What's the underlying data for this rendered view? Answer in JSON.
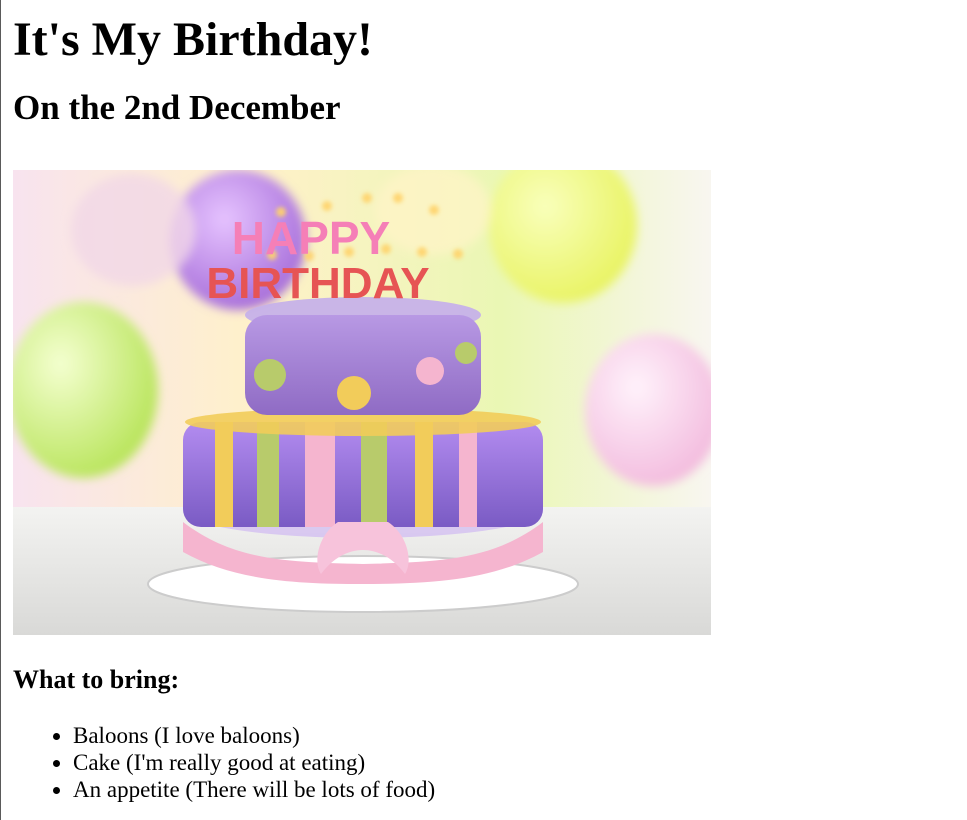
{
  "page": {
    "title": "It's My Birthday!",
    "subtitle": "On the 2nd December"
  },
  "hero_image": {
    "alt": "Happy Birthday cake with balloons",
    "cake_text_line1": "HAPPY",
    "cake_text_line2": "BIRTHDAY"
  },
  "bring": {
    "heading": "What to bring:",
    "items": [
      "Baloons (I love baloons)",
      "Cake (I'm really good at eating)",
      "An appetite (There will be lots of food)"
    ]
  },
  "colors": {
    "balloon_purple": "#a46ad8",
    "balloon_yellow": "#e7f25a",
    "balloon_green": "#b8e45a",
    "balloon_pink": "#f2b8dc",
    "cake_purple": "#a787d8",
    "cake_pink": "#f5b5cf",
    "cake_yellow": "#f2cc5a",
    "cake_green": "#b8cb6b"
  }
}
